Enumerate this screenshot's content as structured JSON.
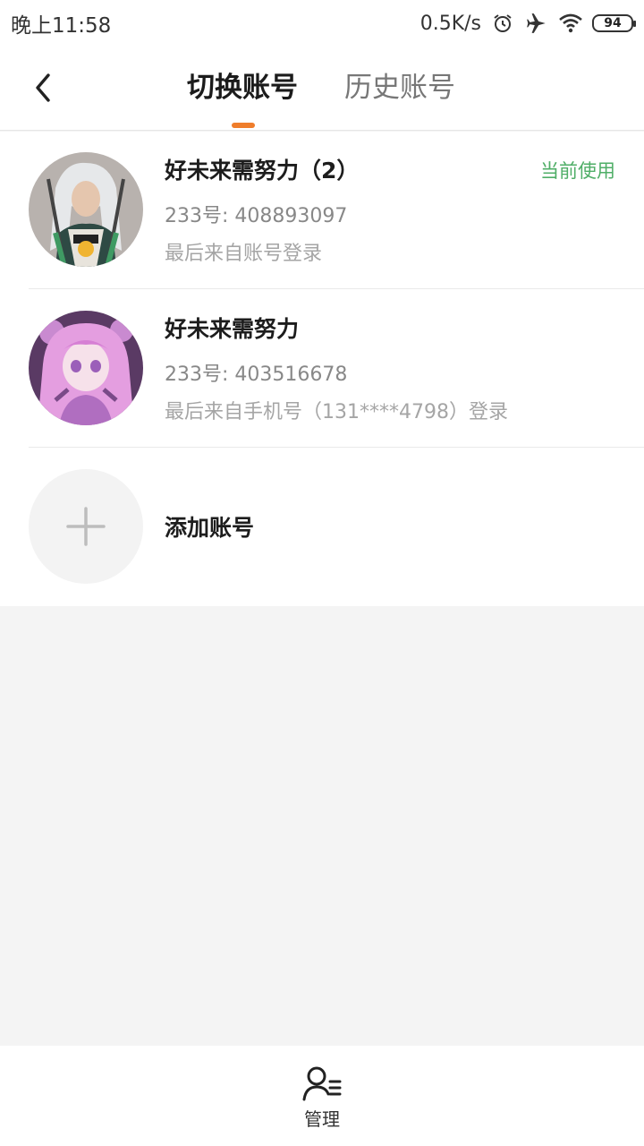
{
  "status_bar": {
    "time": "晚上11:58",
    "net_speed": "0.5K/s",
    "battery": "94",
    "icons": [
      "alarm-icon",
      "airplane-icon",
      "wifi-icon",
      "battery-icon"
    ]
  },
  "header": {
    "tabs": [
      {
        "label": "切换账号",
        "active": true
      },
      {
        "label": "历史账号",
        "active": false
      }
    ],
    "accent": "#ef7d2b"
  },
  "accounts": [
    {
      "name": "好未来需努力（2）",
      "id_line": "233号: 408893097",
      "login_info": "最后来自账号登录",
      "badge": "当前使用"
    },
    {
      "name": "好未来需努力",
      "id_line": "233号: 403516678",
      "login_info": "最后来自手机号（131****4798）登录"
    }
  ],
  "add_account": {
    "label": "添加账号"
  },
  "bottom_bar": {
    "manage_label": "管理"
  },
  "colors": {
    "badge_green": "#4fae67",
    "background": "#f4f4f4"
  }
}
